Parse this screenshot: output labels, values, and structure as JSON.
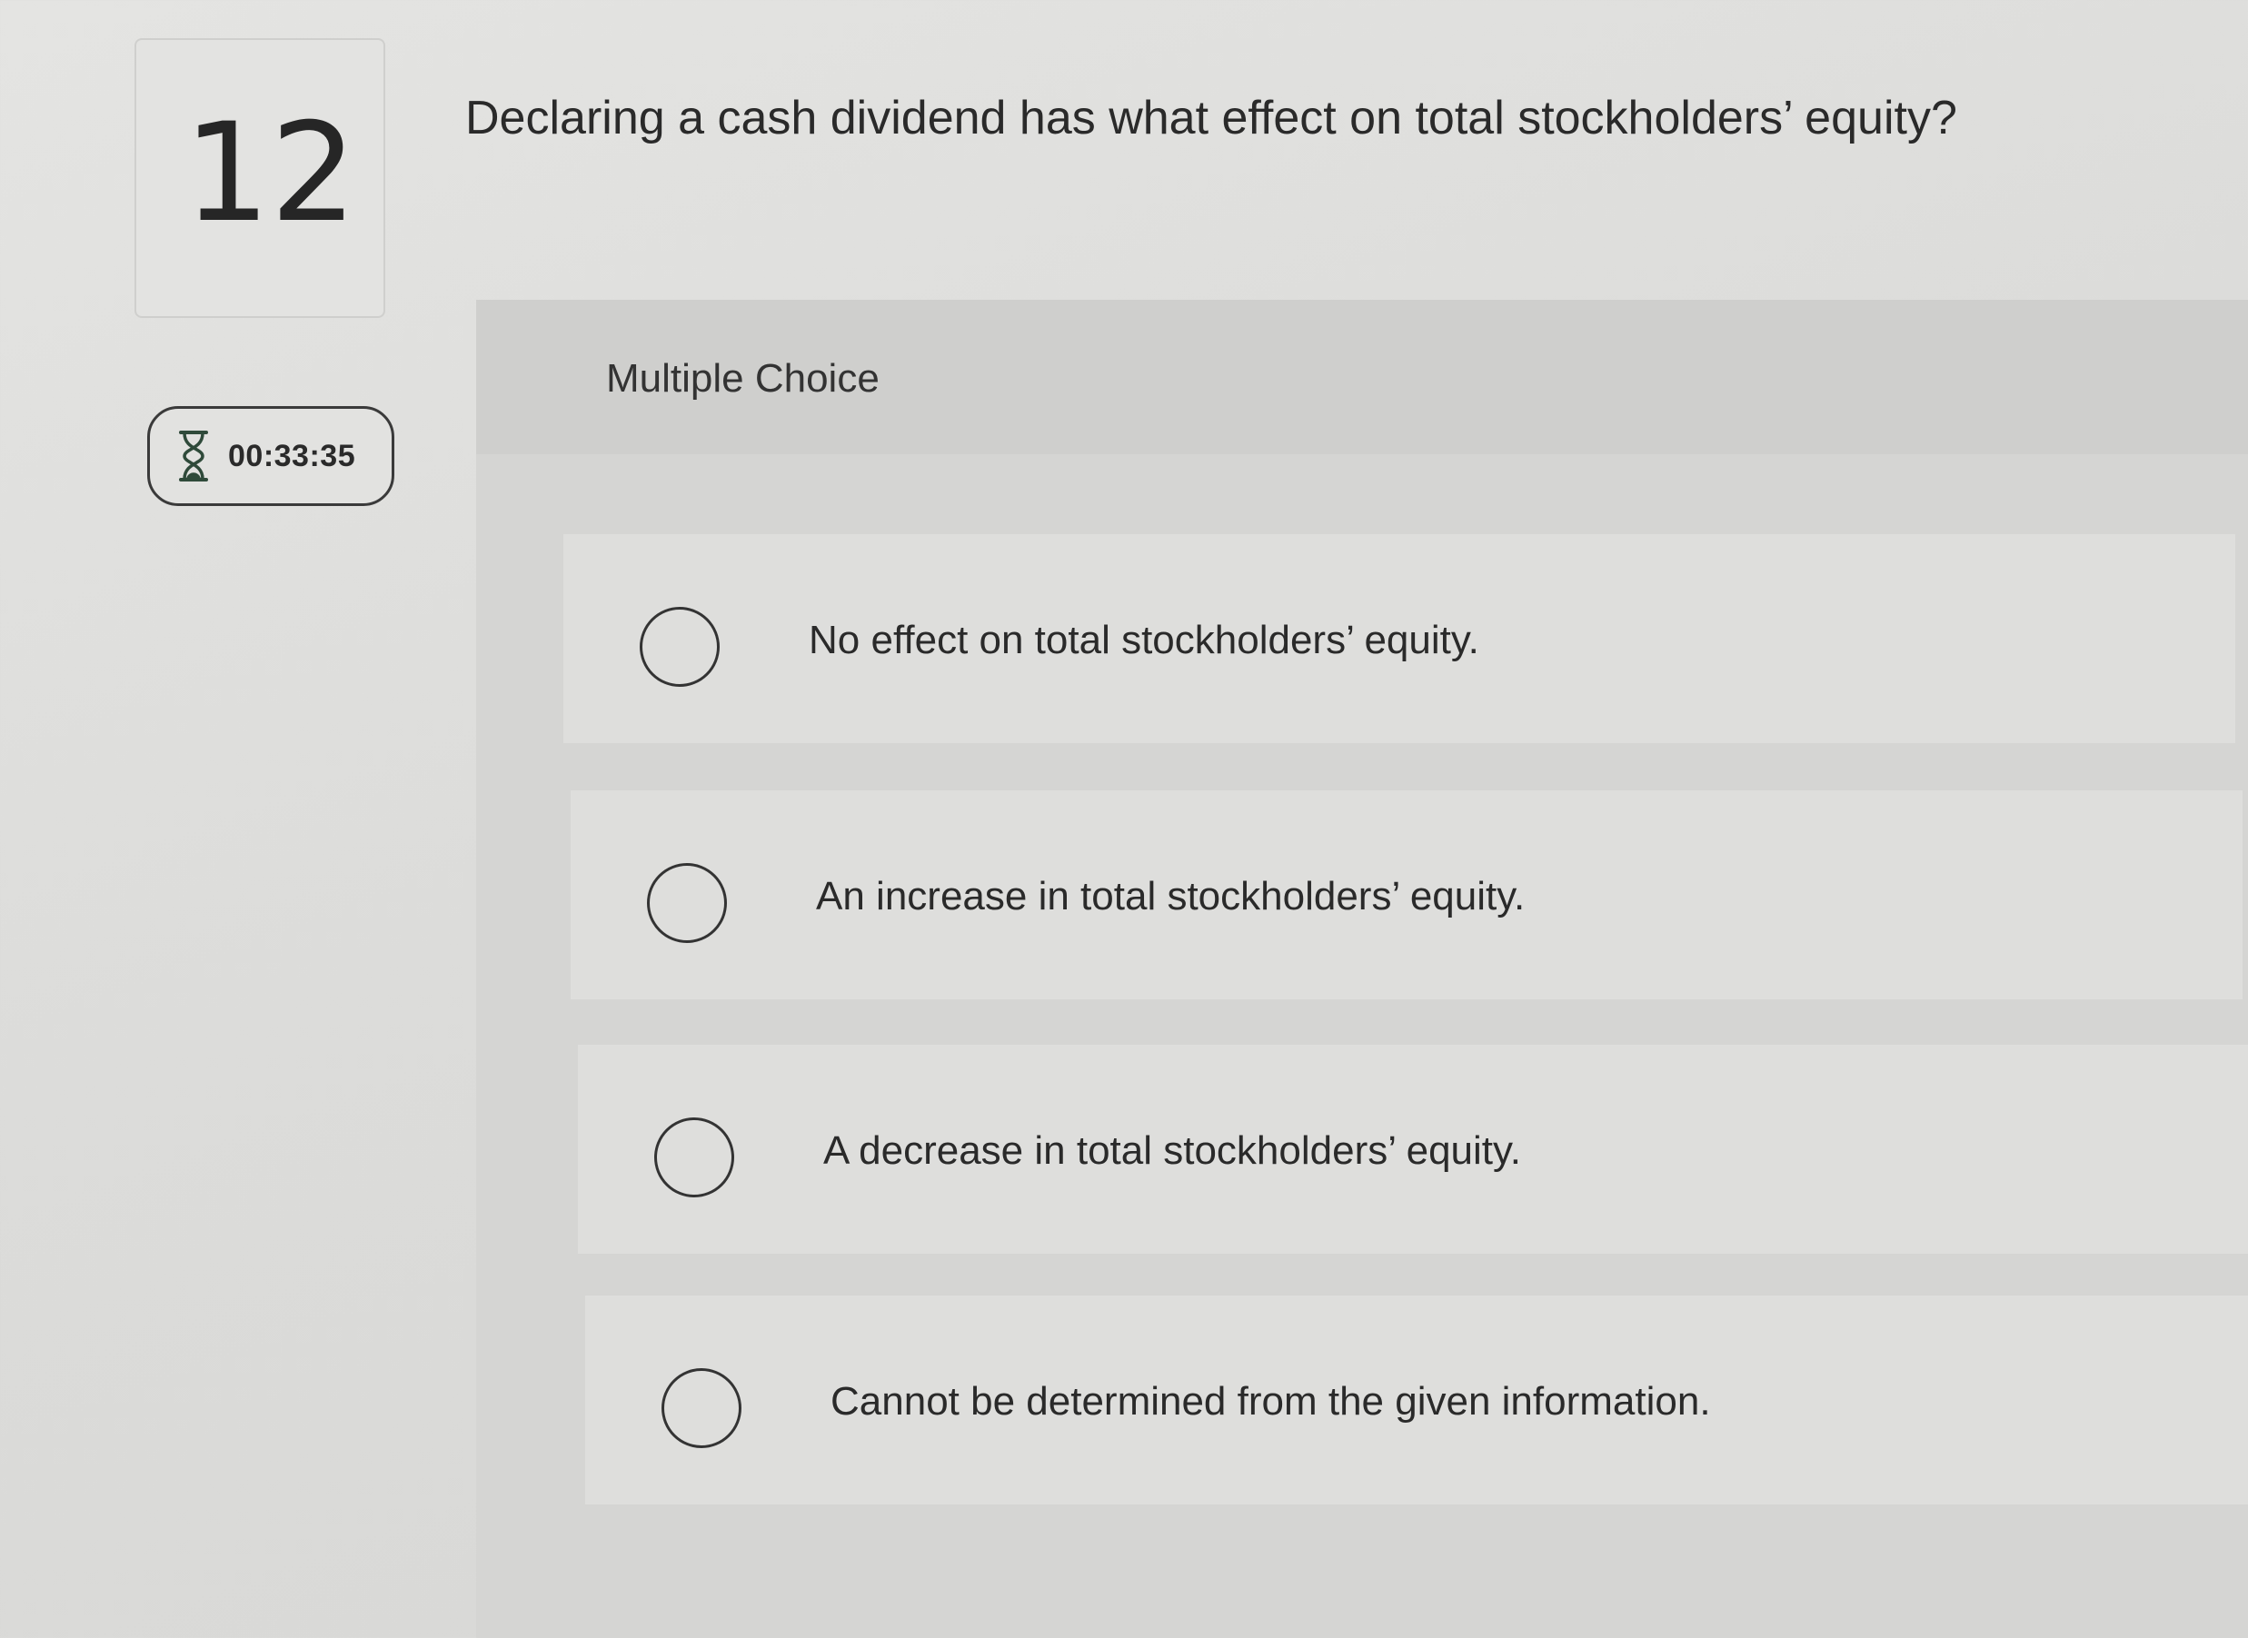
{
  "question": {
    "number": "12",
    "text": "Declaring a cash dividend has what effect on total stockholders’ equity?"
  },
  "timer": {
    "icon": "hourglass-icon",
    "time": "00:33:35"
  },
  "answer_section": {
    "type_label": "Multiple Choice",
    "options": [
      {
        "label": "No effect on total stockholders’ equity.",
        "selected": false
      },
      {
        "label": "An increase in total stockholders’ equity.",
        "selected": false
      },
      {
        "label": "A decrease in total stockholders’ equity.",
        "selected": false
      },
      {
        "label": "Cannot be determined from the given information.",
        "selected": false
      }
    ]
  },
  "colors": {
    "background": "#dcdcda",
    "text": "#2a2a2a",
    "radio_border": "#333333",
    "timer_border": "#3a3a3a"
  }
}
